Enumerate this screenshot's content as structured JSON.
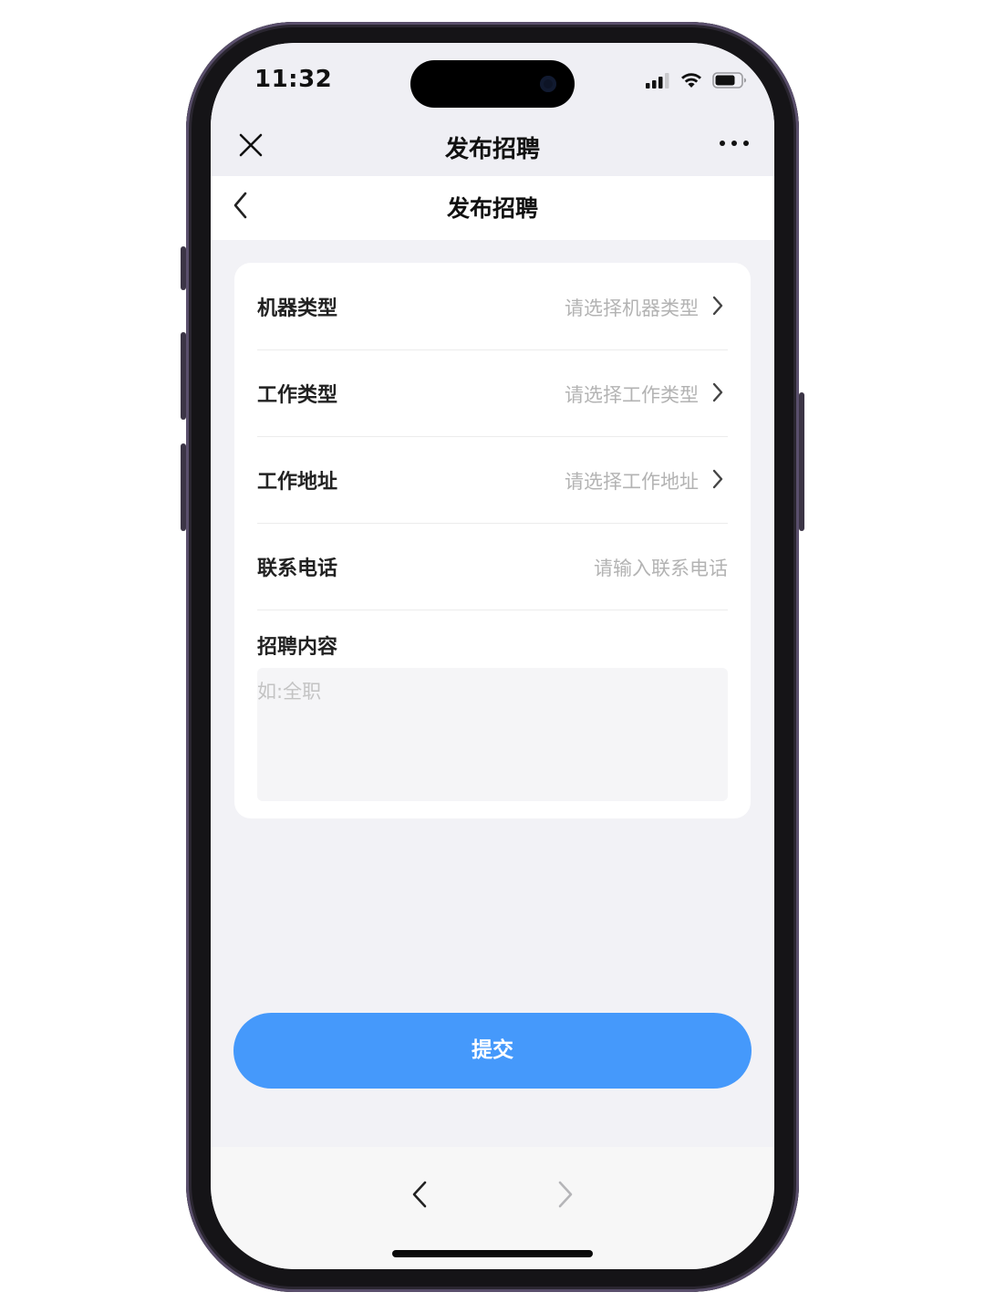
{
  "status_bar": {
    "time": "11:32",
    "icons": [
      "signal-icon",
      "wifi-icon",
      "battery-icon"
    ]
  },
  "mini_program_bar": {
    "title": "发布招聘",
    "close_icon": "close-icon",
    "more_icon": "more-icon"
  },
  "page_header": {
    "title": "发布招聘",
    "back_icon": "chevron-left-icon"
  },
  "form": {
    "rows": [
      {
        "label": "机器类型",
        "placeholder": "请选择机器类型",
        "arrow": true
      },
      {
        "label": "工作类型",
        "placeholder": "请选择工作类型",
        "arrow": true
      },
      {
        "label": "工作地址",
        "placeholder": "请选择工作地址",
        "arrow": true
      },
      {
        "label": "联系电话",
        "placeholder": "请输入联系电话",
        "arrow": false
      }
    ],
    "content": {
      "label": "招聘内容",
      "placeholder": "如:全职"
    }
  },
  "submit": {
    "label": "提交",
    "color": "#4599fb"
  },
  "bottom_nav": {
    "back_icon": "chevron-left-icon",
    "forward_icon": "chevron-right-icon"
  }
}
